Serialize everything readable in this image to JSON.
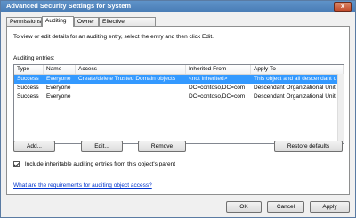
{
  "window": {
    "title": "Advanced Security Settings for System",
    "close_label": "x"
  },
  "tabs": [
    {
      "label": "Permissions"
    },
    {
      "label": "Auditing"
    },
    {
      "label": "Owner"
    },
    {
      "label": "Effective Permissions"
    }
  ],
  "panel": {
    "intro": "To view or edit details for an auditing entry, select the entry and then click Edit.",
    "entries_label": "Auditing entries:"
  },
  "table": {
    "columns": [
      "Type",
      "Name",
      "Access",
      "Inherited From",
      "Apply To"
    ],
    "rows": [
      [
        "Success",
        "Everyone",
        "Create/delete Trusted Domain objects",
        "<not inherited>",
        "This object and all descendant o"
      ],
      [
        "Success",
        "Everyone",
        "",
        "DC=contoso,DC=com",
        "Descendant Organizational Unit"
      ],
      [
        "Success",
        "Everyone",
        "",
        "DC=contoso,DC=com",
        "Descendant Organizational Unit"
      ]
    ]
  },
  "buttons": {
    "add": "Add...",
    "edit": "Edit...",
    "remove": "Remove",
    "restore": "Restore defaults",
    "ok": "OK",
    "cancel": "Cancel",
    "apply": "Apply"
  },
  "checkbox": {
    "label": "Include inheritable auditing entries from this object's parent",
    "checked": true
  },
  "help_link": "What are the requirements for auditing object access?"
}
